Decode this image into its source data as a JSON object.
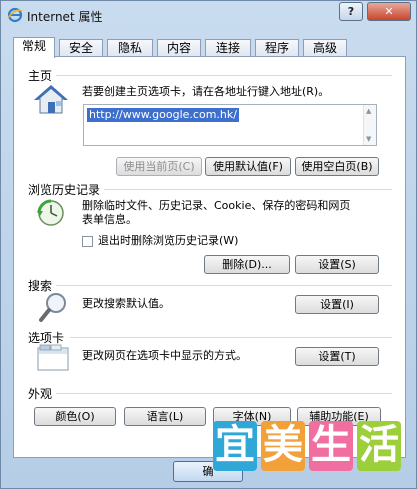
{
  "window": {
    "title": "Internet 属性",
    "help_label": "?",
    "close_label": "✕"
  },
  "tabs": [
    {
      "label": "常规",
      "active": true
    },
    {
      "label": "安全"
    },
    {
      "label": "隐私"
    },
    {
      "label": "内容"
    },
    {
      "label": "连接"
    },
    {
      "label": "程序"
    },
    {
      "label": "高级"
    }
  ],
  "home": {
    "title": "主页",
    "instruction": "若要创建主页选项卡，请在各地址行键入地址(R)。",
    "url": "http://www.google.com.hk/",
    "buttons": {
      "use_current": "使用当前页(C)",
      "use_default": "使用默认值(F)",
      "use_blank": "使用空白页(B)"
    }
  },
  "history": {
    "title": "浏览历史记录",
    "description_line1": "删除临时文件、历史记录、Cookie、保存的密码和网页",
    "description_line2": "表单信息。",
    "checkbox_label": "退出时删除浏览历史记录(W)",
    "delete_button": "删除(D)...",
    "settings_button": "设置(S)"
  },
  "search": {
    "title": "搜索",
    "description": "更改搜索默认值。",
    "settings_button": "设置(I)"
  },
  "tabs_section": {
    "title": "选项卡",
    "description": "更改网页在选项卡中显示的方式。",
    "settings_button": "设置(T)"
  },
  "appearance": {
    "title": "外观",
    "buttons": {
      "colors": "颜色(O)",
      "languages": "语言(L)",
      "fonts": "字体(N)",
      "accessibility": "辅助功能(E)"
    }
  },
  "footer": {
    "ok_partial": "确"
  },
  "watermark": {
    "chars": [
      "宜",
      "美",
      "生",
      "活"
    ]
  }
}
